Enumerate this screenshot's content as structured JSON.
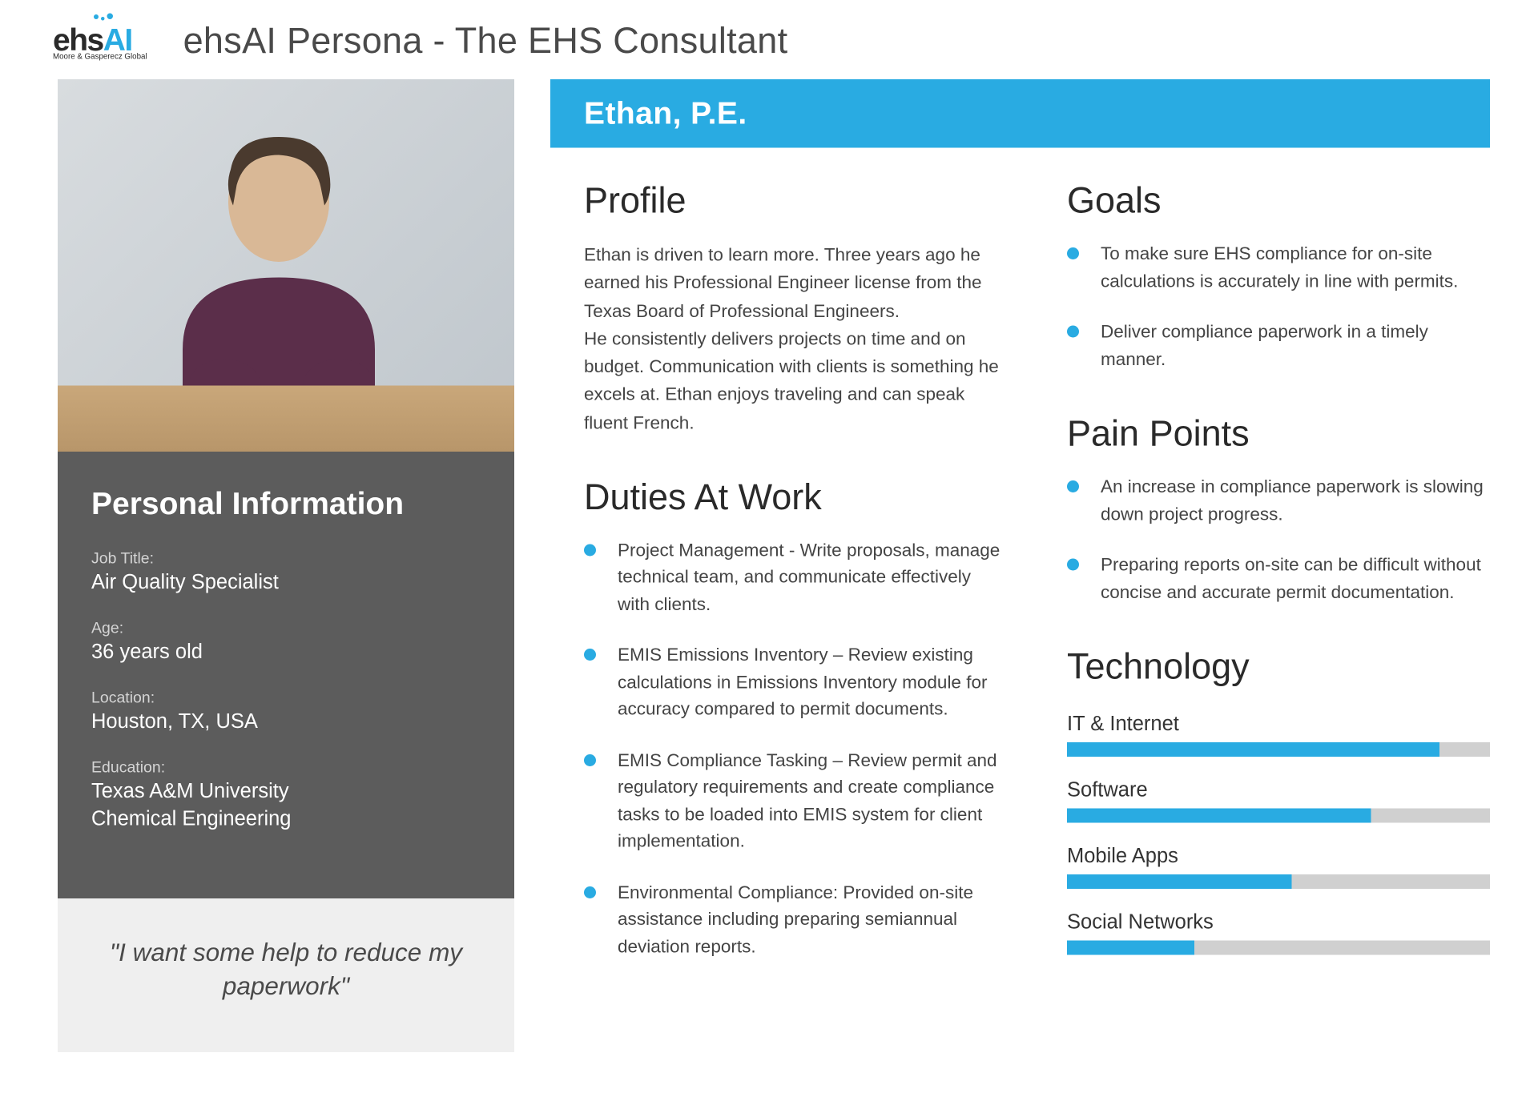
{
  "header": {
    "logo_text_prefix": "ehs",
    "logo_text_suffix": "AI",
    "logo_subtitle": "Moore & Gasperecz Global",
    "page_title": "ehsAI Persona - The EHS Consultant"
  },
  "persona_name": "Ethan, P.E.",
  "personal_info": {
    "heading": "Personal Information",
    "fields": [
      {
        "label": "Job Title:",
        "value": "Air Quality Specialist"
      },
      {
        "label": "Age:",
        "value": "36 years old"
      },
      {
        "label": "Location:",
        "value": "Houston, TX, USA"
      },
      {
        "label": "Education:",
        "value": "Texas A&M University\nChemical Engineering"
      }
    ]
  },
  "quote": "\"I want some help to reduce my paperwork\"",
  "profile": {
    "heading": "Profile",
    "text": "Ethan is driven to learn more. Three years ago he earned his Professional Engineer license from the Texas Board of Professional Engineers.\nHe consistently delivers projects on time and on budget. Communication with clients is something he excels at. Ethan enjoys traveling and can speak fluent French."
  },
  "duties": {
    "heading": "Duties At Work",
    "items": [
      "Project Management - Write proposals, manage technical team, and communicate effectively with clients.",
      "EMIS Emissions Inventory – Review existing calculations in Emissions Inventory module for accuracy compared to permit documents.",
      "EMIS Compliance Tasking – Review permit and regulatory requirements and create compliance tasks to be loaded into EMIS system for client implementation.",
      "Environmental Compliance: Provided on-site assistance including preparing semiannual deviation reports."
    ]
  },
  "goals": {
    "heading": "Goals",
    "items": [
      "To make sure EHS compliance for on-site calculations is accurately in line with permits.",
      "Deliver compliance paperwork in a timely manner."
    ]
  },
  "pain_points": {
    "heading": "Pain Points",
    "items": [
      "An increase in compliance paperwork is slowing down project progress.",
      "Preparing reports on-site can be difficult without concise and accurate permit documentation."
    ]
  },
  "technology": {
    "heading": "Technology",
    "items": [
      {
        "label": "IT & Internet",
        "percent": 88
      },
      {
        "label": "Software",
        "percent": 72
      },
      {
        "label": "Mobile Apps",
        "percent": 53
      },
      {
        "label": "Social Networks",
        "percent": 30
      }
    ]
  }
}
